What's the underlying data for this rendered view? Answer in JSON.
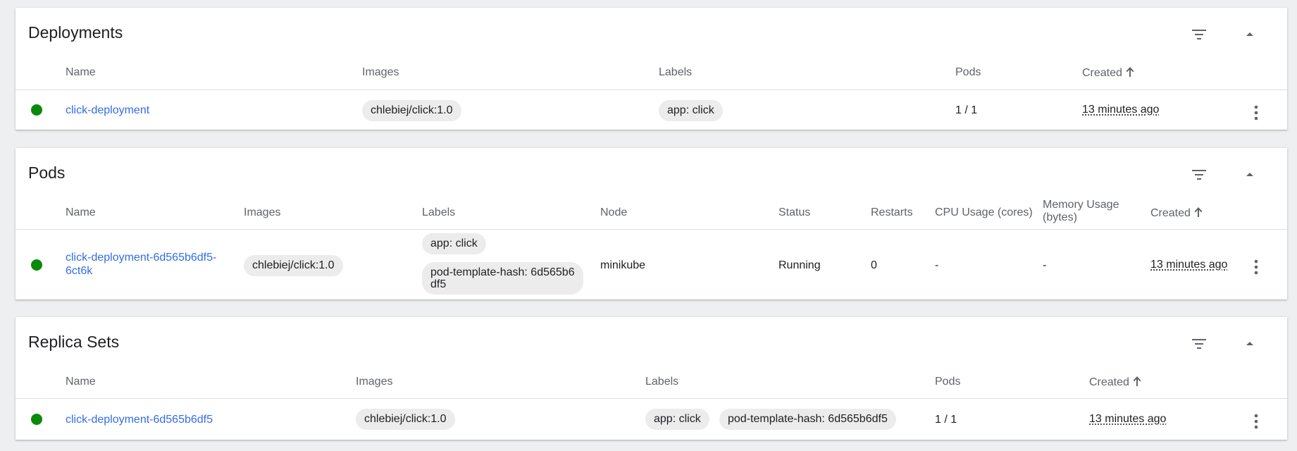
{
  "colors": {
    "page_bg": "#eeeff0",
    "card_bg": "#ffffff",
    "link": "#326de6",
    "status_ok": "#0a8a0a",
    "chip_bg": "#ececec",
    "header_text": "#5f6368"
  },
  "icons": {
    "filter": "filter-list-icon",
    "collapse": "arrow-drop-up-icon",
    "sort": "arrow-upward-icon",
    "menu": "more-vert-icon",
    "status": "status-success-dot"
  },
  "deployments": {
    "title": "Deployments",
    "headers": {
      "name": "Name",
      "images": "Images",
      "labels": "Labels",
      "pods": "Pods",
      "created": "Created"
    },
    "rows": [
      {
        "status": "running",
        "name": "click-deployment",
        "images": [
          "chlebiej/click:1.0"
        ],
        "labels": [
          "app: click"
        ],
        "pods": "1 / 1",
        "created": "13 minutes ago"
      }
    ]
  },
  "pods": {
    "title": "Pods",
    "headers": {
      "name": "Name",
      "images": "Images",
      "labels": "Labels",
      "node": "Node",
      "status": "Status",
      "restarts": "Restarts",
      "cpu": "CPU Usage (cores)",
      "memory_line1": "Memory Usage",
      "memory_line2": "(bytes)",
      "created": "Created"
    },
    "rows": [
      {
        "status_dot": "running",
        "name_line1": "click-deployment-6d565b6df5-",
        "name_line2": "6ct6k",
        "images": [
          "chlebiej/click:1.0"
        ],
        "labels": [
          "app: click",
          "pod-template-hash: 6d565b6df5"
        ],
        "label2_line1": "pod-template-hash: 6d565b6",
        "label2_line2": "df5",
        "node": "minikube",
        "status": "Running",
        "restarts": "0",
        "cpu": "-",
        "memory": "-",
        "created": "13 minutes ago"
      }
    ]
  },
  "replica_sets": {
    "title": "Replica Sets",
    "headers": {
      "name": "Name",
      "images": "Images",
      "labels": "Labels",
      "pods": "Pods",
      "created": "Created"
    },
    "rows": [
      {
        "status": "running",
        "name": "click-deployment-6d565b6df5",
        "images": [
          "chlebiej/click:1.0"
        ],
        "labels": [
          "app: click",
          "pod-template-hash: 6d565b6df5"
        ],
        "pods": "1 / 1",
        "created": "13 minutes ago"
      }
    ]
  }
}
